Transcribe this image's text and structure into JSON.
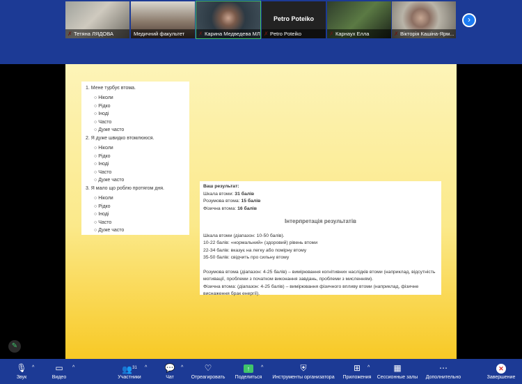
{
  "participants": [
    {
      "name": "Тетяна ЛЯДОВА",
      "muted": true
    },
    {
      "name": "Медичний факультет",
      "muted": false
    },
    {
      "name": "Карина Медведева МЛ...",
      "muted": true
    },
    {
      "name": "Petro Poteiko",
      "muted": true,
      "avatar_text": "Petro Poteiko"
    },
    {
      "name": "Карнаух Елла",
      "muted": true
    },
    {
      "name": "Вікторія Кашіна-Ярм...",
      "muted": true
    }
  ],
  "questions": [
    {
      "title": "1. Мене турбує втома.",
      "options": [
        "Ніколи",
        "Рідко",
        "Іноді",
        "Часто",
        "Дуже часто"
      ]
    },
    {
      "title": "2. Я дуже швидко втомлююся.",
      "options": [
        "Ніколи",
        "Рідко",
        "Іноді",
        "Часто",
        "Дуже часто"
      ]
    },
    {
      "title": "3. Я мало що роблю протягом дня.",
      "options": [
        "Ніколи",
        "Рідко",
        "Іноді",
        "Часто",
        "Дуже часто"
      ]
    }
  ],
  "results": {
    "heading": "Ваш результат:",
    "lines": [
      {
        "label": "Шкала втоми: ",
        "value": "31 балів"
      },
      {
        "label": "Розумова втома: ",
        "value": "15 балів"
      },
      {
        "label": "Фізична втома: ",
        "value": "16 балів"
      }
    ],
    "interp_title": "Інтерпретація результатів",
    "scale_lines": [
      "Шкала втоми (діапазон: 10-50 балів).",
      "10-22 балів: «нормальний» (здоровий) рівень втоми",
      "22-34 балів: вказує на легку або помірну втому",
      "35-50 балів: свідчить про сильну втому"
    ],
    "mental": "Розумова втома (діапазон: 4-25 балів) – вимірювання когнітивних наслідків втоми (наприклад, відсутність мотивації, проблеми з початком виконання завдань, проблеми з мисленням).",
    "physical": "Фізична втома: (діапазон: 4-25 балів) – вимірювання фізичного впливу втоми (наприклад, фізичне виснаження брак енергії)."
  },
  "toolbar": {
    "audio": "Звук",
    "video": "Видео",
    "participants": "Участники",
    "participants_count": "31",
    "chat": "Чат",
    "react": "Отреагировать",
    "share": "Поделиться",
    "host_tools": "Инструменты организатора",
    "apps": "Приложения",
    "breakout": "Сессионные залы",
    "more": "Дополнительно",
    "end": "Завершение"
  },
  "colors": {
    "toolbar_bg": "#1c3a95",
    "active_speaker": "#3fc46a",
    "share_green": "#3fc46a",
    "end_red": "#d92d27"
  }
}
